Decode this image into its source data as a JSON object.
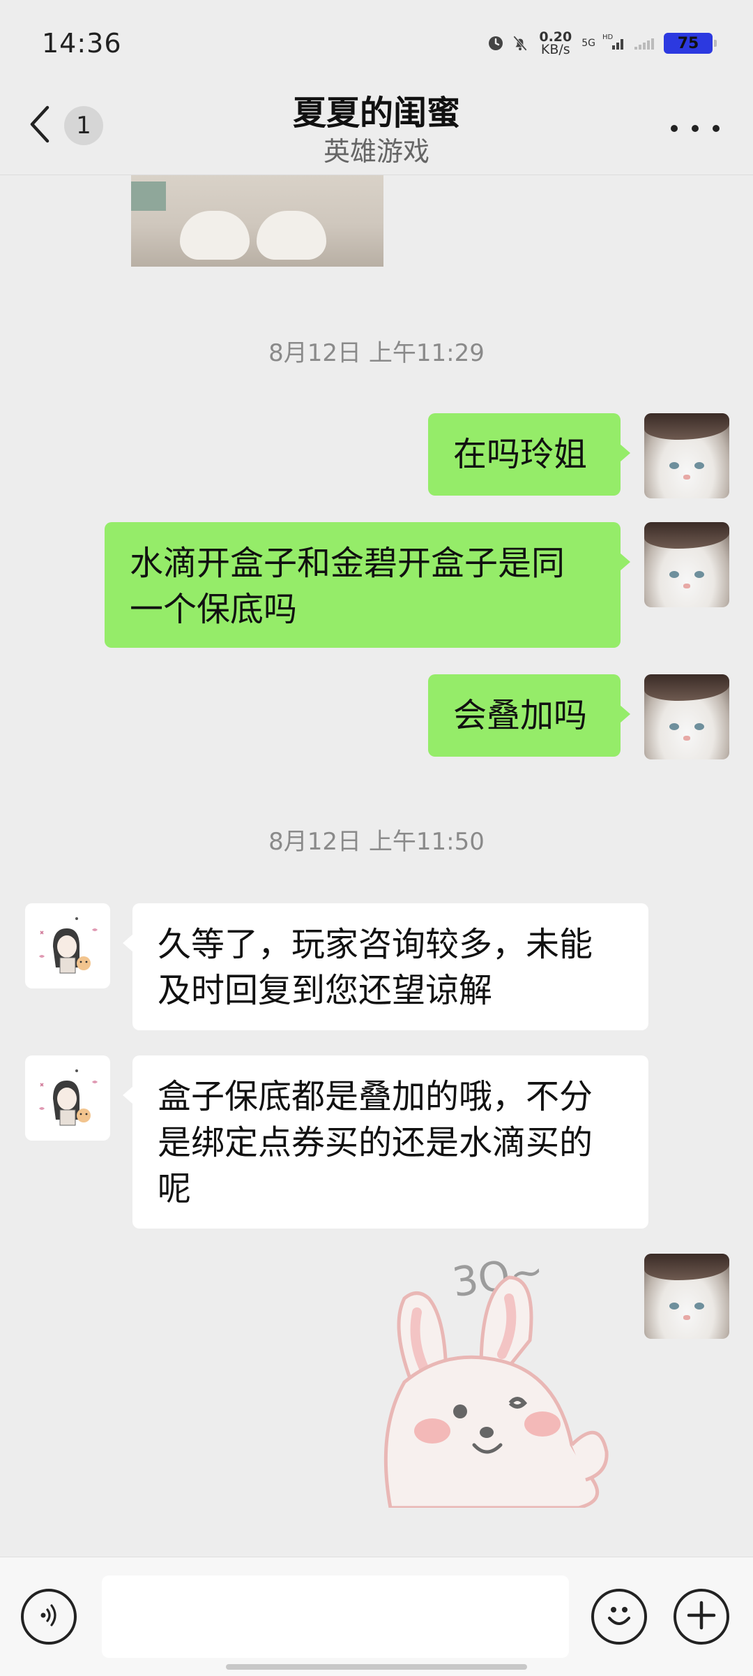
{
  "status_bar": {
    "time": "14:36",
    "net_speed_value": "0.20",
    "net_speed_unit": "KB/s",
    "net_type": "5G",
    "net_hd": "HD",
    "battery": "75"
  },
  "header": {
    "back_badge": "1",
    "title": "夏夏的闺蜜",
    "subtitle": "英雄游戏"
  },
  "timestamps": [
    "8月12日 上午11:29",
    "8月12日 上午11:50"
  ],
  "messages": [
    {
      "sender": "me",
      "text": "在吗玲姐"
    },
    {
      "sender": "me",
      "text": "水滴开盒子和金碧开盒子是同一个保底吗"
    },
    {
      "sender": "me",
      "text": "会叠加吗"
    },
    {
      "sender": "them",
      "text": "久等了，玩家咨询较多，未能及时回复到您还望谅解"
    },
    {
      "sender": "them",
      "text": "盒子保底都是叠加的哦，不分是绑定点券买的还是水滴买的呢"
    }
  ],
  "sticker_text": "3Q~",
  "input": {
    "value": "",
    "placeholder": ""
  },
  "icons": {
    "voice": "voice-icon",
    "emoji": "emoji-icon",
    "plus": "plus-icon",
    "back": "back-chevron-icon",
    "more": "more-icon"
  },
  "colors": {
    "background": "#ededed",
    "my_bubble": "#95ec69",
    "their_bubble": "#ffffff",
    "battery": "#2c39e0"
  }
}
